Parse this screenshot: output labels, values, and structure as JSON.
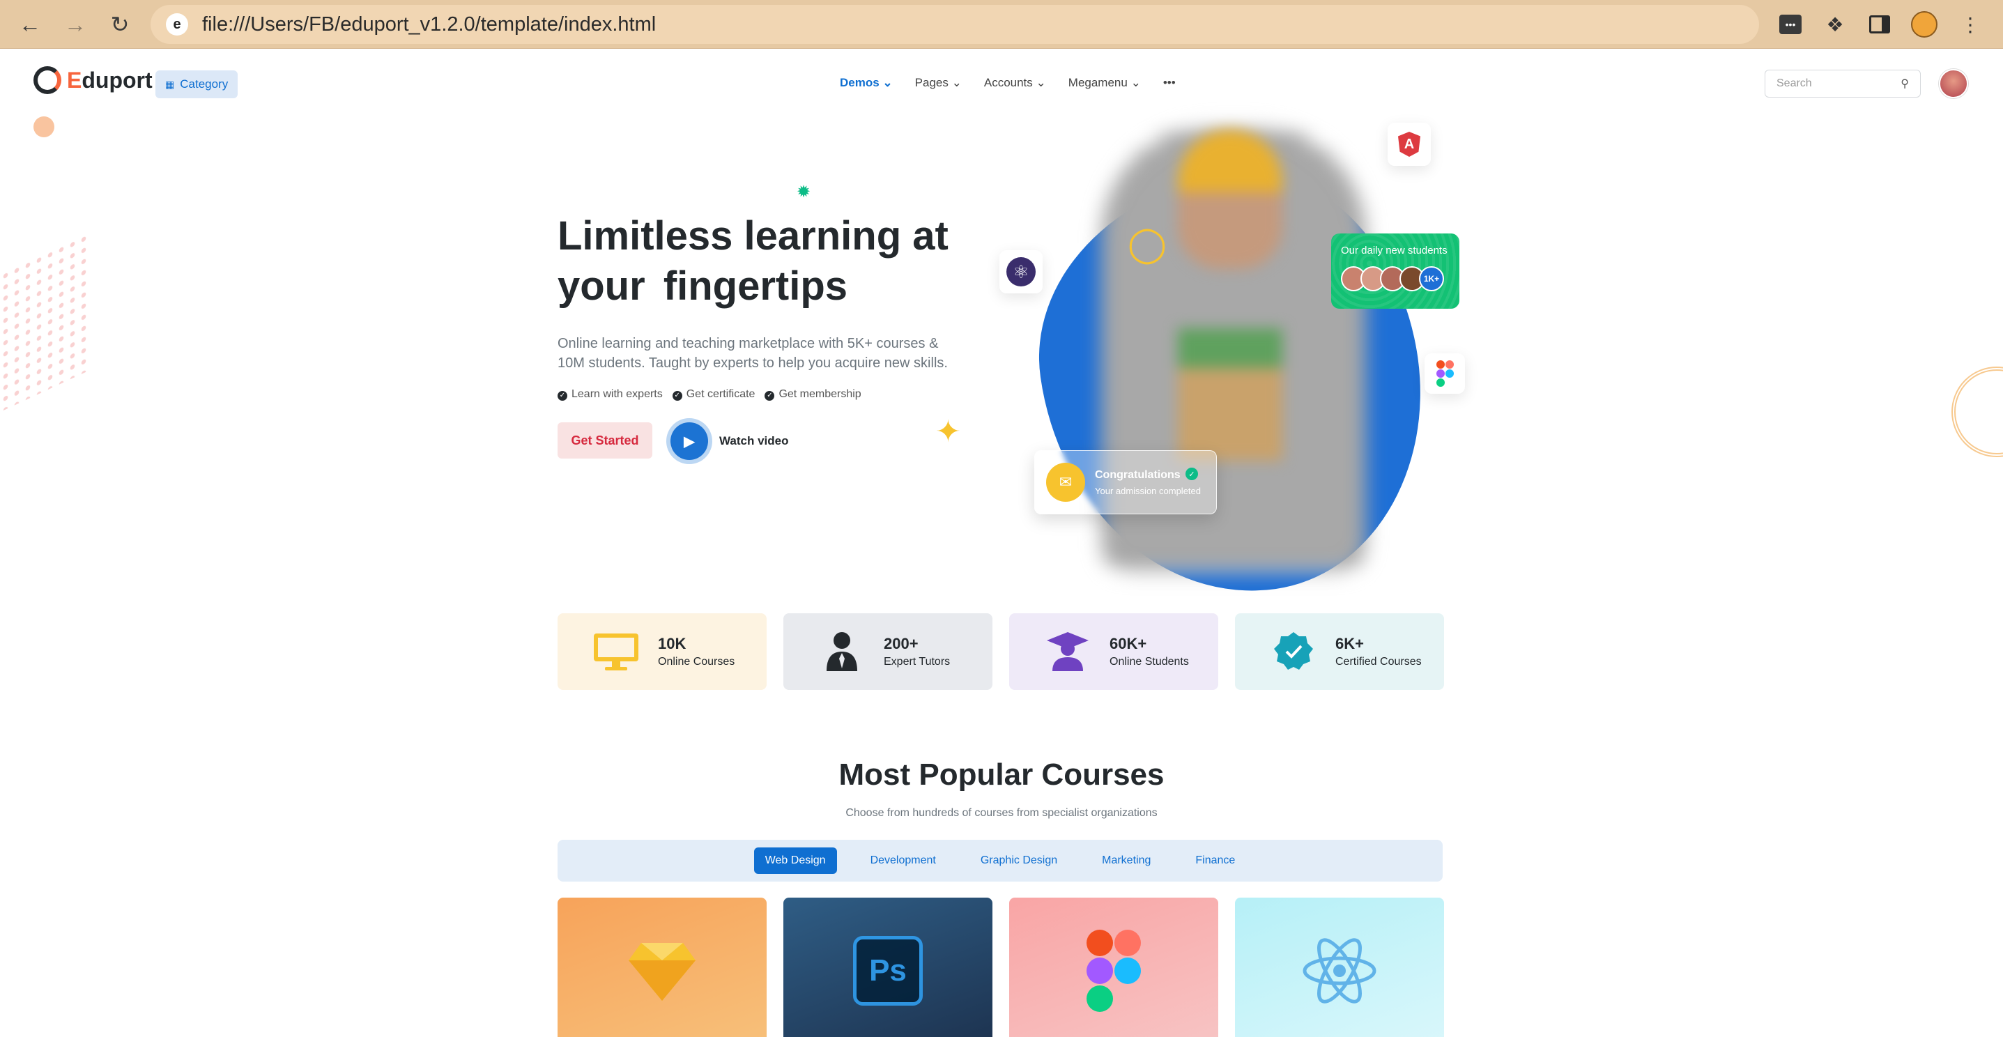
{
  "browser": {
    "url": "file:///Users/FB/eduport_v1.2.0/template/index.html",
    "back_icon": "arrow-left-icon",
    "forward_icon": "arrow-right-icon",
    "reload_icon": "reload-icon",
    "extension_icons": [
      "ellipsis-extension-icon",
      "puzzle-icon",
      "sidebar-icon",
      "profile-icon",
      "kebab-menu-icon"
    ]
  },
  "header": {
    "logo_text_accent": "E",
    "logo_text_rest": "duport",
    "category_label": "Category",
    "nav": [
      "Demos",
      "Pages",
      "Accounts",
      "Megamenu"
    ],
    "more_label": "•••",
    "search_placeholder": "Search"
  },
  "hero": {
    "title_line1": "Limitless learning at",
    "title_line2_prefix": "your",
    "title_highlight": "fingertips",
    "description": "Online learning and teaching marketplace with 5K+ courses & 10M students. Taught by experts to help you acquire new skills.",
    "checks": [
      "Learn with experts",
      "Get certificate",
      "Get membership"
    ],
    "cta_label": "Get Started",
    "video_label": "Watch video",
    "students_card_title": "Our daily new students",
    "students_more": "1K+",
    "congrats_title": "Congratulations",
    "congrats_sub": "Your admission completed",
    "angular_letter": "A"
  },
  "stats": [
    {
      "value": "10K",
      "label": "Online Courses",
      "bg": "#fdf3e1",
      "icon": "monitor-icon"
    },
    {
      "value": "200+",
      "label": "Expert Tutors",
      "bg": "#e8eaee",
      "icon": "tutor-icon"
    },
    {
      "value": "60K+",
      "label": "Online Students",
      "bg": "#efeaf8",
      "icon": "graduate-icon"
    },
    {
      "value": "6K+",
      "label": "Certified Courses",
      "bg": "#e6f4f5",
      "icon": "certified-badge-icon"
    }
  ],
  "courses": {
    "title": "Most Popular Courses",
    "subtitle": "Choose from hundreds of courses from specialist organizations",
    "tabs": [
      "Web Design",
      "Development",
      "Graphic Design",
      "Marketing",
      "Finance"
    ],
    "active_tab": "Web Design",
    "card_icons": [
      "sketch-icon",
      "photoshop-icon",
      "figma-icon",
      "react-icon"
    ],
    "ps_label": "Ps"
  },
  "colors": {
    "primary": "#0f6fd1",
    "warning": "#f7c32e",
    "success": "#0cbc87",
    "danger": "#d6293e",
    "brand_orange": "#f7653d"
  }
}
